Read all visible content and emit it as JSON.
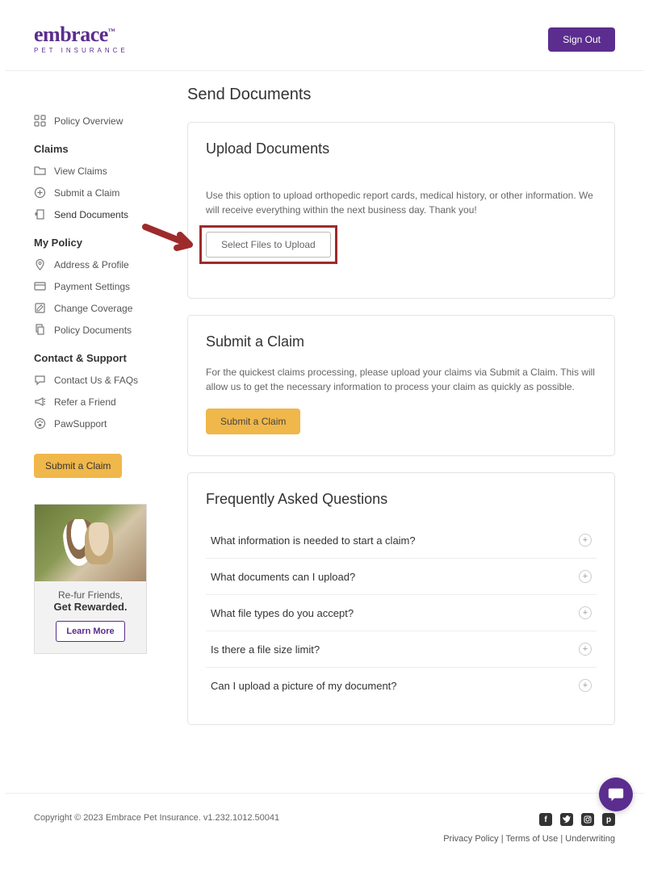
{
  "header": {
    "logo_main": "embrace",
    "logo_sub": "PET INSURANCE",
    "sign_out": "Sign Out"
  },
  "sidebar": {
    "overview": "Policy Overview",
    "section_claims": "Claims",
    "view_claims": "View Claims",
    "submit_claim": "Submit a Claim",
    "send_documents": "Send Documents",
    "section_policy": "My Policy",
    "address_profile": "Address & Profile",
    "payment_settings": "Payment Settings",
    "change_coverage": "Change Coverage",
    "policy_documents": "Policy Documents",
    "section_support": "Contact & Support",
    "contact_faqs": "Contact Us & FAQs",
    "refer_friend": "Refer a Friend",
    "paw_support": "PawSupport",
    "submit_button": "Submit a Claim",
    "promo_line1": "Re-fur Friends,",
    "promo_line2": "Get Rewarded.",
    "learn_more": "Learn More"
  },
  "main": {
    "page_title": "Send Documents",
    "upload": {
      "title": "Upload Documents",
      "desc": "Use this option to upload orthopedic report cards, medical history, or other information. We will receive everything within the next business day. Thank you!",
      "button": "Select Files to Upload"
    },
    "submit": {
      "title": "Submit a Claim",
      "desc": "For the quickest claims processing, please upload your claims via Submit a Claim. This will allow us to get the necessary information to process your claim as quickly as possible.",
      "button": "Submit a Claim"
    },
    "faq": {
      "title": "Frequently Asked Questions",
      "items": [
        "What information is needed to start a claim?",
        "What documents can I upload?",
        "What file types do you accept?",
        "Is there a file size limit?",
        "Can I upload a picture of my document?"
      ]
    }
  },
  "footer": {
    "copyright": "Copyright © 2023   Embrace Pet Insurance. v1.232.1012.50041",
    "privacy": "Privacy Policy",
    "terms": "Terms of Use",
    "underwriting": "Underwriting",
    "sep": "  |  "
  }
}
